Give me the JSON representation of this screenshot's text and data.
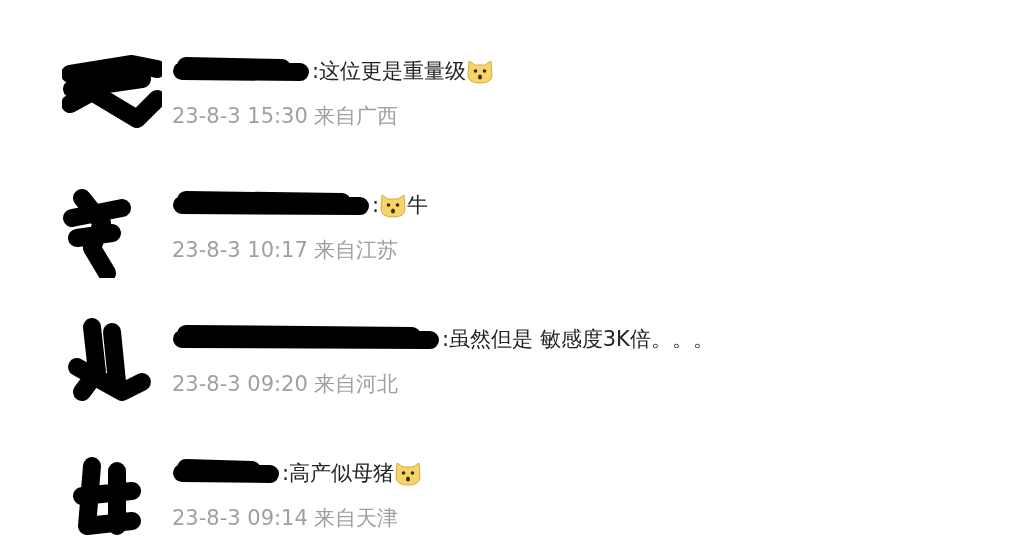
{
  "comments": [
    {
      "parts": [
        {
          "kind": "text",
          "text": ":这位更是重量级"
        },
        {
          "kind": "emoji"
        }
      ],
      "time": "23-8-3 15:30 来自广西"
    },
    {
      "parts": [
        {
          "kind": "text",
          "text": ":"
        },
        {
          "kind": "emoji"
        },
        {
          "kind": "text",
          "text": "牛"
        }
      ],
      "time": "23-8-3 10:17 来自江苏"
    },
    {
      "parts": [
        {
          "kind": "text",
          "text": ":虽然但是 敏感度3K倍。。。"
        }
      ],
      "time": "23-8-3 09:20 来自河北"
    },
    {
      "parts": [
        {
          "kind": "text",
          "text": ":高产似母猪"
        },
        {
          "kind": "emoji"
        }
      ],
      "time": "23-8-3 09:14 来自天津"
    }
  ]
}
